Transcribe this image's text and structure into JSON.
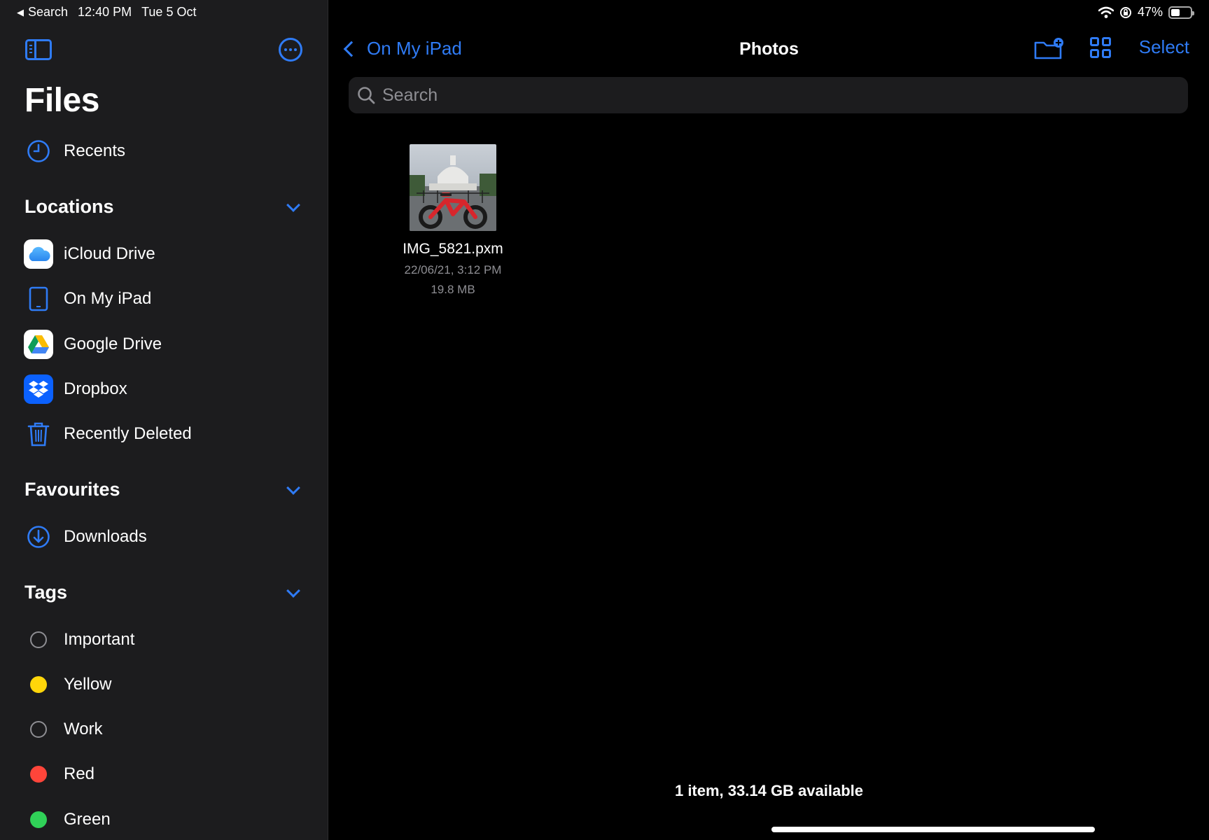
{
  "status_bar": {
    "back_app": "Search",
    "time": "12:40 PM",
    "date": "Tue 5 Oct",
    "battery": "47%",
    "battery_level": 0.47
  },
  "sidebar": {
    "title": "Files",
    "recents": "Recents",
    "locations": {
      "header": "Locations",
      "items": [
        {
          "label": "iCloud Drive",
          "icon": "icloud-icon"
        },
        {
          "label": "On My iPad",
          "icon": "ipad-icon"
        },
        {
          "label": "Google Drive",
          "icon": "google-drive-icon"
        },
        {
          "label": "Dropbox",
          "icon": "dropbox-icon"
        },
        {
          "label": "Recently Deleted",
          "icon": "trash-icon"
        }
      ]
    },
    "favourites": {
      "header": "Favourites",
      "items": [
        {
          "label": "Downloads",
          "icon": "download-icon"
        }
      ]
    },
    "tags": {
      "header": "Tags",
      "items": [
        {
          "label": "Important",
          "color": ""
        },
        {
          "label": "Yellow",
          "color": "#ffd60a"
        },
        {
          "label": "Work",
          "color": ""
        },
        {
          "label": "Red",
          "color": "#ff453a"
        },
        {
          "label": "Green",
          "color": "#30d158"
        }
      ]
    }
  },
  "main": {
    "back_label": "On My iPad",
    "title": "Photos",
    "select_label": "Select",
    "search_placeholder": "Search",
    "files": [
      {
        "name": "IMG_5821.pxm",
        "date": "22/06/21, 3:12 PM",
        "size": "19.8 MB"
      }
    ],
    "footer": "1 item, 33.14 GB available"
  },
  "colors": {
    "accent": "#2f7bf5",
    "sidebar_bg": "#1c1c1e",
    "main_bg": "#000000"
  }
}
